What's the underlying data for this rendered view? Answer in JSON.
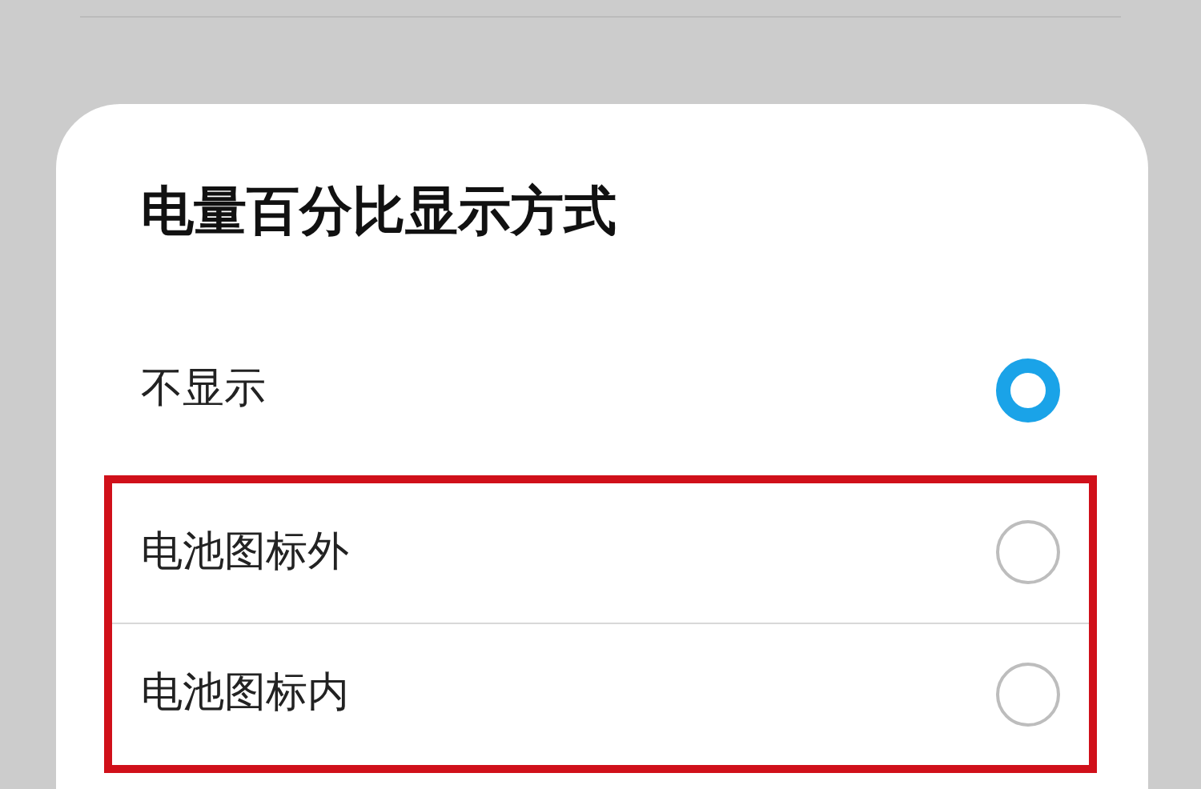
{
  "dialog": {
    "title": "电量百分比显示方式",
    "options": [
      {
        "label": "不显示",
        "selected": true,
        "highlighted": false
      },
      {
        "label": "电池图标外",
        "selected": false,
        "highlighted": true
      },
      {
        "label": "电池图标内",
        "selected": false,
        "highlighted": true
      }
    ]
  }
}
